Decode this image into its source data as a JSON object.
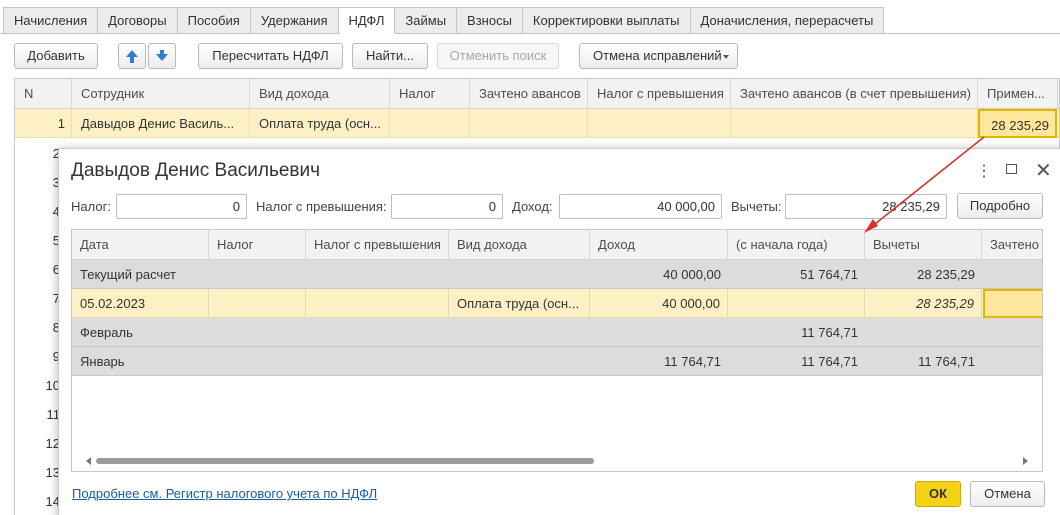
{
  "tabs": [
    "Начисления",
    "Договоры",
    "Пособия",
    "Удержания",
    "НДФЛ",
    "Займы",
    "Взносы",
    "Корректировки выплаты",
    "Доначисления, перерасчеты"
  ],
  "active_tab": "НДФЛ",
  "toolbar": {
    "add": "Добавить",
    "move_up_icon": "arrow-up-icon",
    "move_down_icon": "arrow-down-icon",
    "recalc": "Пересчитать НДФЛ",
    "find": "Найти...",
    "cancel_search": "Отменить поиск",
    "cancel_corrections": "Отмена исправлений"
  },
  "main_grid": {
    "columns": [
      "N",
      "Сотрудник",
      "Вид дохода",
      "Налог",
      "Зачтено авансов",
      "Налог с превышения",
      "Зачтено авансов (в счет превышения)",
      "Примен..."
    ],
    "row": {
      "n": "1",
      "employee": "Давыдов Денис Василь...",
      "income_type": "Оплата труда (осн...",
      "applied": "28 235,29"
    },
    "row_numbers": [
      "2",
      "3",
      "4",
      "5",
      "6",
      "7",
      "8",
      "9",
      "10",
      "11",
      "12",
      "13",
      "14"
    ]
  },
  "dialog": {
    "title": "Давыдов Денис Васильевич",
    "fields": {
      "tax_label": "Налог:",
      "tax_value": "0",
      "excess_label": "Налог с превышения:",
      "excess_value": "0",
      "income_label": "Доход:",
      "income_value": "40 000,00",
      "deductions_label": "Вычеты:",
      "deductions_value": "28 235,29"
    },
    "details_button": "Подробно",
    "columns": [
      "Дата",
      "Налог",
      "Налог с превышения",
      "Вид дохода",
      "Доход",
      "(с начала года)",
      "Вычеты",
      "Зачтено"
    ],
    "rows": [
      {
        "date": "Текущий расчет",
        "income": "40 000,00",
        "ytd": "51 764,71",
        "deductions": "28 235,29"
      },
      {
        "date": "05.02.2023",
        "income_type": "Оплата труда (осн...",
        "income": "40 000,00",
        "deductions": "28 235,29"
      },
      {
        "date": "Февраль",
        "ytd": "11 764,71"
      },
      {
        "date": "Январь",
        "income": "11 764,71",
        "ytd": "11 764,71",
        "deductions": "11 764,71"
      }
    ],
    "link": "Подробнее см. Регистр налогового учета по НДФЛ",
    "ok": "ОК",
    "cancel": "Отмена"
  },
  "colors": {
    "selected_row": "#fdf0c5",
    "selected_cell_border": "#e3b400",
    "grey_row": "#dcdcdc",
    "ok_button": "#f5d215",
    "annotation_arrow": "#d9342b",
    "link": "#1a5c9c"
  }
}
